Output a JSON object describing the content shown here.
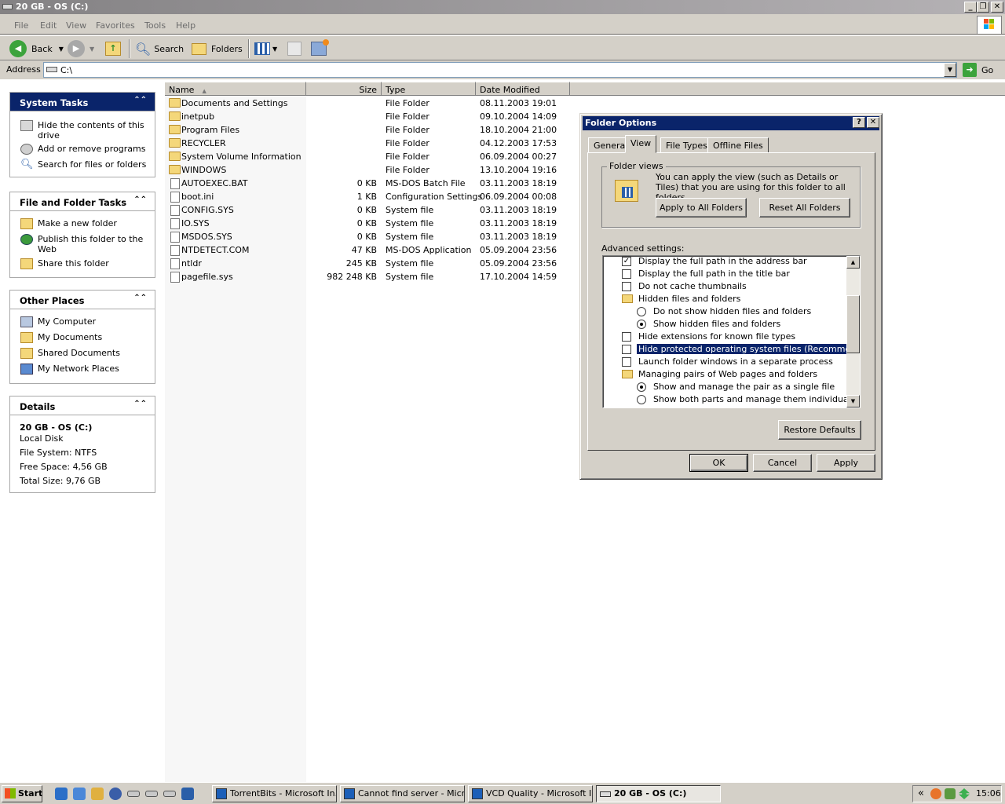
{
  "window": {
    "title": "20 GB - OS (C:)"
  },
  "menu": [
    "File",
    "Edit",
    "View",
    "Favorites",
    "Tools",
    "Help"
  ],
  "toolbar": {
    "back": "Back",
    "search": "Search",
    "folders": "Folders"
  },
  "address": {
    "label": "Address",
    "value": "C:\\",
    "go": "Go"
  },
  "tasks": {
    "system": {
      "title": "System Tasks",
      "items": [
        "Hide the contents of this drive",
        "Add or remove programs",
        "Search for files or folders"
      ]
    },
    "file": {
      "title": "File and Folder Tasks",
      "items": [
        "Make a new folder",
        "Publish this folder to the Web",
        "Share this folder"
      ]
    },
    "other": {
      "title": "Other Places",
      "items": [
        "My Computer",
        "My Documents",
        "Shared Documents",
        "My Network Places"
      ]
    },
    "details": {
      "title": "Details",
      "name": "20 GB - OS (C:)",
      "type": "Local Disk",
      "fs": "File System: NTFS",
      "free": "Free Space: 4,56 GB",
      "total": "Total Size: 9,76 GB"
    }
  },
  "columns": {
    "name": "Name",
    "size": "Size",
    "type": "Type",
    "date": "Date Modified"
  },
  "files": [
    {
      "name": "Documents and Settings",
      "size": "",
      "type": "File Folder",
      "date": "08.11.2003 19:01",
      "folder": true
    },
    {
      "name": "inetpub",
      "size": "",
      "type": "File Folder",
      "date": "09.10.2004 14:09",
      "folder": true
    },
    {
      "name": "Program Files",
      "size": "",
      "type": "File Folder",
      "date": "18.10.2004 21:00",
      "folder": true
    },
    {
      "name": "RECYCLER",
      "size": "",
      "type": "File Folder",
      "date": "04.12.2003 17:53",
      "folder": true
    },
    {
      "name": "System Volume Information",
      "size": "",
      "type": "File Folder",
      "date": "06.09.2004 00:27",
      "folder": true
    },
    {
      "name": "WINDOWS",
      "size": "",
      "type": "File Folder",
      "date": "13.10.2004 19:16",
      "folder": true
    },
    {
      "name": "AUTOEXEC.BAT",
      "size": "0 KB",
      "type": "MS-DOS Batch File",
      "date": "03.11.2003 18:19",
      "folder": false
    },
    {
      "name": "boot.ini",
      "size": "1 KB",
      "type": "Configuration Settings",
      "date": "06.09.2004 00:08",
      "folder": false
    },
    {
      "name": "CONFIG.SYS",
      "size": "0 KB",
      "type": "System file",
      "date": "03.11.2003 18:19",
      "folder": false
    },
    {
      "name": "IO.SYS",
      "size": "0 KB",
      "type": "System file",
      "date": "03.11.2003 18:19",
      "folder": false
    },
    {
      "name": "MSDOS.SYS",
      "size": "0 KB",
      "type": "System file",
      "date": "03.11.2003 18:19",
      "folder": false
    },
    {
      "name": "NTDETECT.COM",
      "size": "47 KB",
      "type": "MS-DOS Application",
      "date": "05.09.2004 23:56",
      "folder": false
    },
    {
      "name": "ntldr",
      "size": "245 KB",
      "type": "System file",
      "date": "05.09.2004 23:56",
      "folder": false
    },
    {
      "name": "pagefile.sys",
      "size": "982 248 KB",
      "type": "System file",
      "date": "17.10.2004 14:59",
      "folder": false
    }
  ],
  "dialog": {
    "title": "Folder Options",
    "tabs": [
      "General",
      "View",
      "File Types",
      "Offline Files"
    ],
    "folder_views": {
      "title": "Folder views",
      "text": "You can apply the view (such as Details or Tiles) that you are using for this folder to all folders.",
      "apply": "Apply to All Folders",
      "reset": "Reset All Folders"
    },
    "advanced_label": "Advanced settings:",
    "settings": [
      {
        "kind": "check",
        "checked": true,
        "indent": 0,
        "label": "Display the full path in the address bar"
      },
      {
        "kind": "check",
        "checked": false,
        "indent": 0,
        "label": "Display the full path in the title bar"
      },
      {
        "kind": "check",
        "checked": false,
        "indent": 0,
        "label": "Do not cache thumbnails"
      },
      {
        "kind": "folder",
        "checked": false,
        "indent": 0,
        "label": "Hidden files and folders"
      },
      {
        "kind": "radio",
        "checked": false,
        "indent": 1,
        "label": "Do not show hidden files and folders"
      },
      {
        "kind": "radio",
        "checked": true,
        "indent": 1,
        "label": "Show hidden files and folders"
      },
      {
        "kind": "check",
        "checked": false,
        "indent": 0,
        "label": "Hide extensions for known file types"
      },
      {
        "kind": "check",
        "checked": false,
        "indent": 0,
        "label": "Hide protected operating system files (Recommended)",
        "selected": true
      },
      {
        "kind": "check",
        "checked": false,
        "indent": 0,
        "label": "Launch folder windows in a separate process"
      },
      {
        "kind": "folder",
        "checked": false,
        "indent": 0,
        "label": "Managing pairs of Web pages and folders"
      },
      {
        "kind": "radio",
        "checked": true,
        "indent": 1,
        "label": "Show and manage the pair as a single file"
      },
      {
        "kind": "radio",
        "checked": false,
        "indent": 1,
        "label": "Show both parts and manage them individually"
      }
    ],
    "restore": "Restore Defaults",
    "ok": "OK",
    "cancel": "Cancel",
    "apply": "Apply"
  },
  "taskbar": {
    "start": "Start",
    "tasks": [
      "TorrentBits - Microsoft In...",
      "Cannot find server - Micr...",
      "VCD Quality - Microsoft I...",
      "20 GB - OS (C:)"
    ],
    "clock": "15:06",
    "tray_chevron": "«"
  }
}
